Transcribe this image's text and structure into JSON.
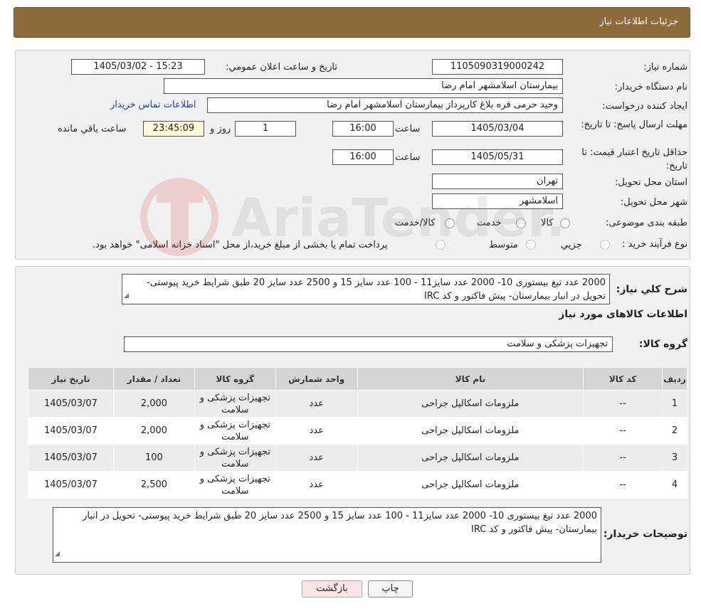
{
  "header": {
    "title": "جزئیات اطلاعات نیاز"
  },
  "details": {
    "need_number_label": "شماره نیاز:",
    "need_number": "1105090319000242",
    "announce_label": "تاریخ و ساعت اعلان عمومي:",
    "announce_value": "1405/03/02 - 15:23",
    "buyer_org_label": "نام دستگاه خریدار:",
    "buyer_org": "بیمارستان اسلامشهر   امام رضا",
    "creator_label": "ایجاد کننده درخواست:",
    "creator": "وحید حرمی قره بلاغ کارپرداز بیمارستان اسلامشهر   امام رضا",
    "contact_link": "اطلاعات تماس خریدار",
    "reply_deadline_label": "مهلت ارسال پاسخ: تا تاریخ:",
    "reply_date": "1405/03/04",
    "time_label": "ساعت",
    "reply_time": "16:00",
    "days_value": "1",
    "days_label": "روز و",
    "remaining_time": "23:45:09",
    "remaining_label": "ساعت باقي مانده",
    "price_validity_label": "حداقل تاریخ اعتبار قیمت: تا تاریخ:",
    "price_date": "1405/05/31",
    "price_time": "16:00",
    "province_label": "استان محل تحویل:",
    "province": "تهران",
    "city_label": "شهر محل تحویل:",
    "city": "اسلامشهر",
    "category_label": "طبقه بندی موضوعی:",
    "category_options": [
      "کالا",
      "خدمت",
      "کالا/خدمت"
    ],
    "process_label": "نوع فرآیند خرید :",
    "process_options": [
      "جزيي",
      "متوسط"
    ],
    "process_note": "پرداخت تمام یا بخشی از مبلغ خرید،از محل \"اسناد خزانه اسلامی\" خواهد بود."
  },
  "summary": {
    "description_label": "شرح کلي نیاز:",
    "description": "2000 عدد تیغ بیستوری 10- 2000 عدد سایز11 - 100 عدد سایز 15  و 2500 عدد سایز 20 طبق شرایط خرید پیوستی- تحویل در انبار بیمارستان- پیش فاکتور و کد IRC",
    "goods_info_title": "اطلاعات کالاهای مورد نیاز",
    "goods_group_label": "گروه کالا:",
    "goods_group": "تجهیزات پزشکی و سلامت"
  },
  "table": {
    "columns": [
      "ردیف",
      "کد کالا",
      "نام کالا",
      "واحد شمارش",
      "گروه کالا",
      "تعداد / مقدار",
      "تاریخ نیاز"
    ],
    "rows": [
      {
        "index": "1",
        "code": "--",
        "name": "ملزومات اسکالپل جراحی",
        "unit": "عدد",
        "group": "تجهیزات پزشکی و سلامت",
        "qty": "2,000",
        "date": "1405/03/07"
      },
      {
        "index": "2",
        "code": "--",
        "name": "ملزومات اسکالپل جراحی",
        "unit": "عدد",
        "group": "تجهیزات پزشکی و سلامت",
        "qty": "2,000",
        "date": "1405/03/07"
      },
      {
        "index": "3",
        "code": "--",
        "name": "ملزومات اسکالپل جراحی",
        "unit": "عدد",
        "group": "تجهیزات پزشکی و سلامت",
        "qty": "100",
        "date": "1405/03/07"
      },
      {
        "index": "4",
        "code": "--",
        "name": "ملزومات اسکالپل جراحی",
        "unit": "عدد",
        "group": "تجهیزات پزشکی و سلامت",
        "qty": "2,500",
        "date": "1405/03/07"
      }
    ]
  },
  "buyer_notes": {
    "label": "توضیحات خریدار:",
    "text": "2000 عدد تیغ بیستوری 10- 2000 عدد سایز11 - 100 عدد سایز 15  و 2500 عدد سایز 20 طبق شرایط خرید پیوستی- تحویل در انبار بیمارستان- پیش فاکتور و کد IRC"
  },
  "buttons": {
    "print": "چاپ",
    "back": "بازگشت"
  },
  "watermark": {
    "text": "AriaTender.neT"
  },
  "colors": {
    "header_bg": "#8c6a3a",
    "link": "#1a3fc0",
    "time_bg": "#fcf9d8",
    "back_btn_bg": "#fde7e6"
  }
}
